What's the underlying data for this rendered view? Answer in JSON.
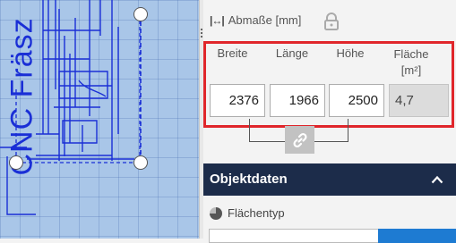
{
  "canvas": {
    "label": "CNC Fräsz"
  },
  "dimensions": {
    "section_title": "Abmaße [mm]",
    "icons": {
      "dimension": "width-arrows-icon",
      "lock": "lock-icon"
    },
    "columns": {
      "breite": {
        "label": "Breite",
        "value": "2376"
      },
      "laenge": {
        "label": "Länge",
        "value": "1966"
      },
      "hoehe": {
        "label": "Höhe",
        "value": "2500"
      },
      "flaeche": {
        "label_line1": "Fläche",
        "label_line2": "[m²]",
        "value": "4,7"
      }
    },
    "highlight_color": "#e0262b",
    "link_icon": "link-icon"
  },
  "object_section": {
    "title": "Objektdaten",
    "collapse_icon": "chevron-up-icon",
    "bar_color": "#1c2c4a",
    "field_label": "Flächentyp",
    "field_icon": "pie-icon",
    "accent": "#1e7bd2"
  }
}
